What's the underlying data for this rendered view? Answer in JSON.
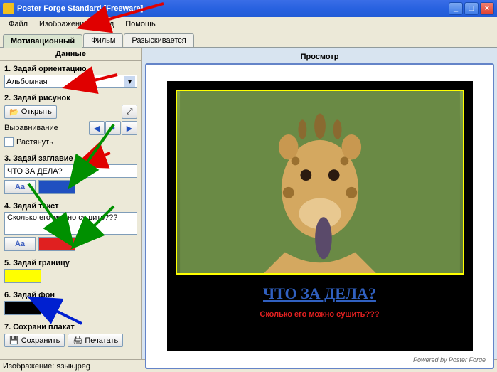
{
  "window": {
    "title": "Poster Forge Standard [Freeware]"
  },
  "menu": {
    "file": "Файл",
    "image": "Изображение",
    "view": "Вид",
    "help": "Помощь"
  },
  "tabs": {
    "motivational": "Мотивационный",
    "film": "Фильм",
    "wanted": "Разыскивается"
  },
  "headers": {
    "data": "Данные",
    "preview": "Просмотр"
  },
  "sections": {
    "s1": "1. Задай ориентацию",
    "s2": "2. Задай рисунок",
    "s3": "3. Задай заглавие",
    "s4": "4. Задай текст",
    "s5": "5. Задай границу",
    "s6": "6. Задай фон",
    "s7": "7. Сохрани плакат"
  },
  "orientation": {
    "value": "Альбомная"
  },
  "picture": {
    "open": "Открыть",
    "align": "Выравнивание",
    "stretch": "Растянуть"
  },
  "title_input": {
    "value": "ЧТО ЗА ДЕЛА?"
  },
  "text_input": {
    "value": "Сколько его можно сушить???"
  },
  "colors": {
    "title": "#2050c0",
    "text": "#e02020",
    "border": "#ffff00",
    "bg": "#000000"
  },
  "save": {
    "save": "Сохранить",
    "print": "Печатать"
  },
  "poster": {
    "title": "ЧТО ЗА ДЕЛА?",
    "text": "Сколько его можно сушить???",
    "powered": "Powered by Poster Forge"
  },
  "status": {
    "text": "Изображение: язык.jpeg"
  },
  "font_label": "Aa"
}
